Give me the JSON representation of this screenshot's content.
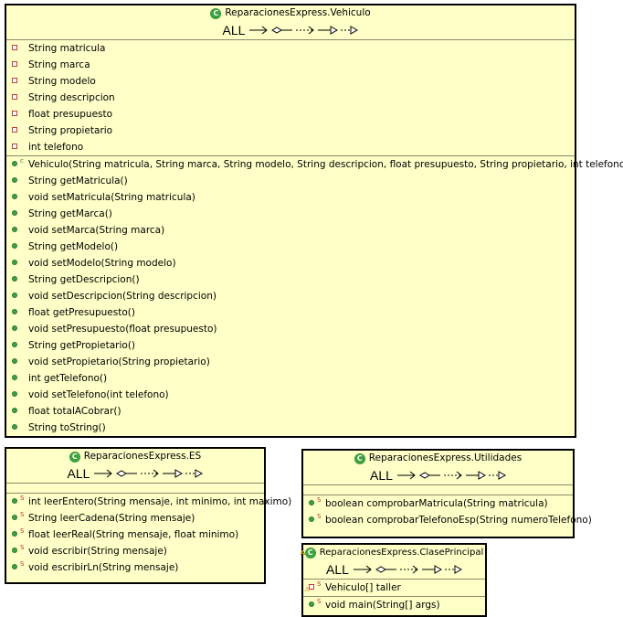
{
  "all_label": "ALL",
  "classes": {
    "vehiculo": {
      "title": "ReparacionesExpress.Vehiculo",
      "fields": [
        "String matricula",
        "String marca",
        "String modelo",
        "String descripcion",
        "float presupuesto",
        "String propietario",
        "int telefono"
      ],
      "methods": [
        "Vehiculo(String matricula, String marca, String modelo, String descripcion, float presupuesto, String propietario, int telefono)",
        "String getMatricula()",
        "void setMatricula(String matricula)",
        "String getMarca()",
        "void setMarca(String marca)",
        "String getModelo()",
        "void setModelo(String modelo)",
        "String getDescripcion()",
        "void setDescripcion(String descripcion)",
        "float getPresupuesto()",
        "void setPresupuesto(float presupuesto)",
        "String getPropietario()",
        "void setPropietario(String propietario)",
        "int getTelefono()",
        "void setTelefono(int telefono)",
        "float totalACobrar()",
        "String toString()"
      ]
    },
    "es": {
      "title": "ReparacionesExpress.ES",
      "methods": [
        "int leerEntero(String mensaje, int minimo, int maximo)",
        "String leerCadena(String mensaje)",
        "float leerReal(String mensaje, float minimo)",
        "void escribir(String mensaje)",
        "void escribirLn(String mensaje)"
      ]
    },
    "utilidades": {
      "title": "ReparacionesExpress.Utilidades",
      "methods": [
        "boolean comprobarMatricula(String matricula)",
        "boolean comprobarTelefonoEsp(String numeroTelefono)"
      ]
    },
    "principal": {
      "title": "ReparacionesExpress.ClasePrincipal",
      "fields": [
        "Vehiculo[] taller"
      ],
      "methods": [
        "void main(String[] args)"
      ]
    }
  },
  "icons": {
    "class": "class-icon",
    "public": "public-method-icon",
    "private": "private-field-icon",
    "static": "static-marker",
    "constructor": "constructor-marker"
  },
  "colors": {
    "box_fill": "#ffffc8",
    "class_icon": "#3ca03c",
    "public": "#3ea03e",
    "private": "#c43c3c"
  }
}
